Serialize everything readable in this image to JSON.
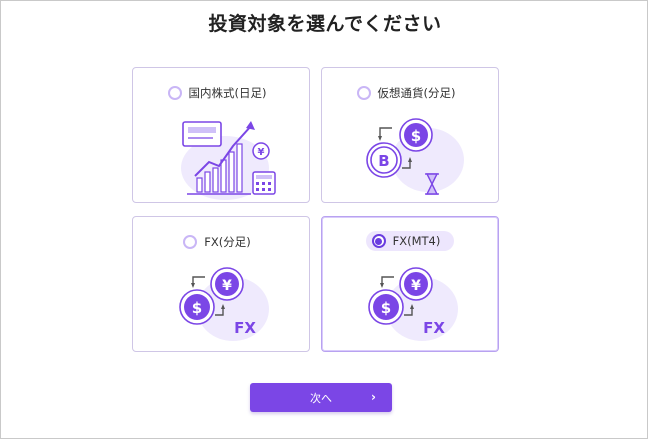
{
  "page": {
    "title": "投資対象を選んでください"
  },
  "options": [
    {
      "label": "国内株式(日足)",
      "selected": false,
      "icon": "stock-chart-icon"
    },
    {
      "label": "仮想通貨(分足)",
      "selected": false,
      "icon": "crypto-exchange-icon"
    },
    {
      "label": "FX(分足)",
      "selected": false,
      "icon": "fx-exchange-icon"
    },
    {
      "label": "FX(MT4)",
      "selected": true,
      "icon": "fx-exchange-icon"
    }
  ],
  "illustration_text": {
    "yen": "¥",
    "dollar": "$",
    "bitcoin": "B",
    "fx": "FX"
  },
  "next_button": {
    "label": "次へ",
    "chevron": "›"
  },
  "colors": {
    "accent": "#7b46e6",
    "accent_dark": "#6a3de0",
    "light_purple": "#ede6fd",
    "border": "#cfc6e6"
  }
}
